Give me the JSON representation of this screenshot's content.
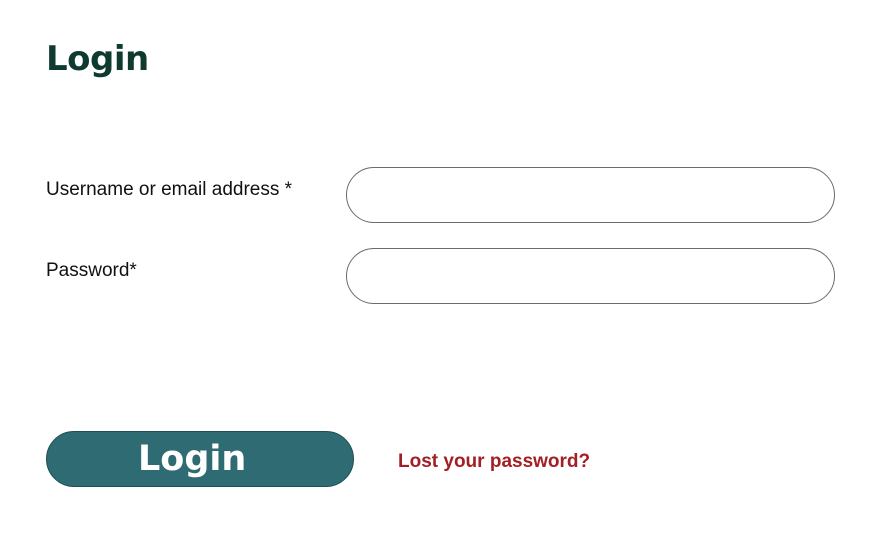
{
  "colors": {
    "title": "#0f3a30",
    "button_bg": "#2e6b72",
    "button_text": "#ffffff",
    "link": "#a31f25",
    "input_border": "#6b6b6b"
  },
  "page": {
    "title": "Login"
  },
  "form": {
    "username": {
      "label": "Username or email address *",
      "value": "",
      "placeholder": ""
    },
    "password": {
      "label": "Password*",
      "value": "",
      "placeholder": ""
    },
    "submit_label": "Login",
    "lost_password_label": "Lost your password?"
  }
}
